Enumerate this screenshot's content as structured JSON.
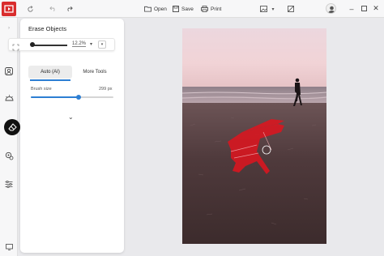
{
  "toolbar": {
    "open_label": "Open",
    "save_label": "Save",
    "print_label": "Print"
  },
  "panel": {
    "title": "Erase Objects",
    "zoom_value": "12.2%",
    "tabs": [
      {
        "label": "Auto (AI)",
        "active": true
      },
      {
        "label": "More Tools",
        "active": false
      }
    ],
    "brush": {
      "label": "Brush size",
      "value_text": "299 px",
      "level": 0.58
    }
  },
  "colors": {
    "accent": "#2d7fd3",
    "brand": "#d92d2d",
    "selection_overlay": "#e0141e"
  },
  "icons": {
    "rail": [
      "portrait-icon",
      "sun-icon",
      "eraser-icon",
      "settings-icon",
      "sliders-icon",
      "monitor-icon"
    ]
  }
}
